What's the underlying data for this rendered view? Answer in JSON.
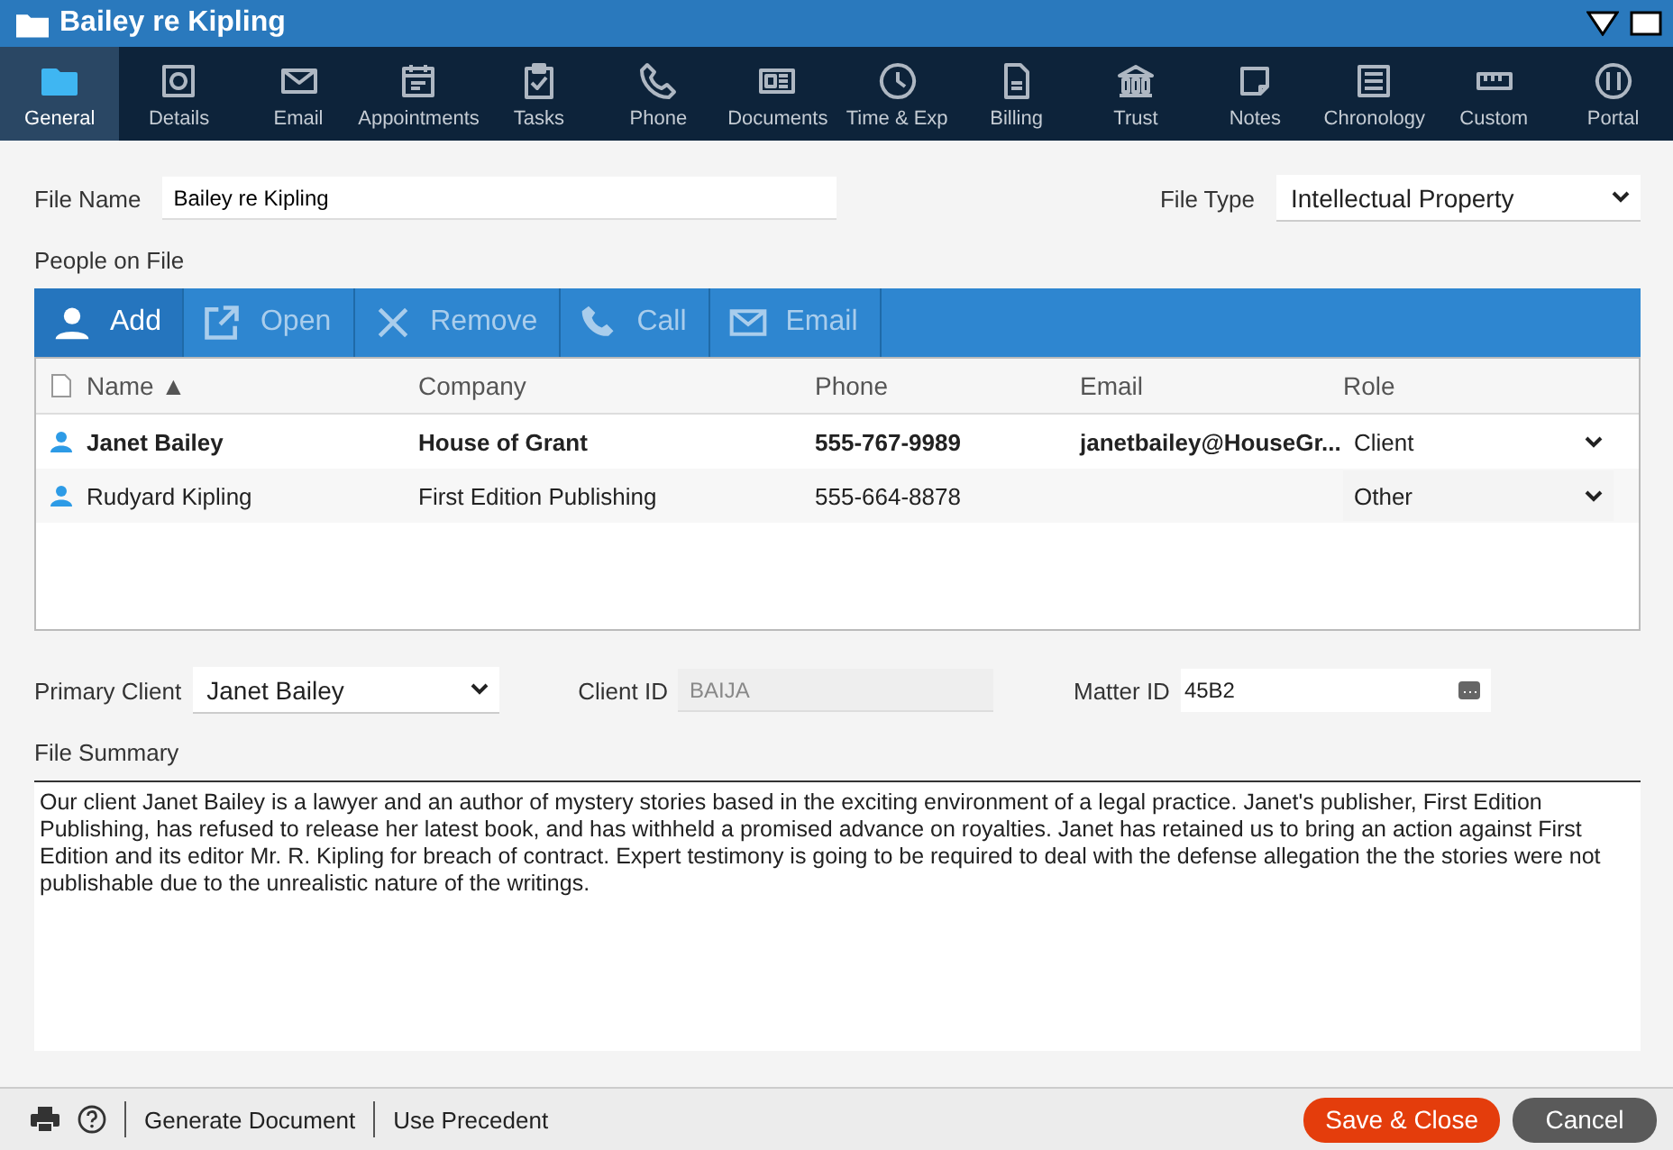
{
  "window": {
    "title": "Bailey re Kipling"
  },
  "tabs": [
    {
      "label": "General",
      "selected": true
    },
    {
      "label": "Details",
      "selected": false
    },
    {
      "label": "Email",
      "selected": false
    },
    {
      "label": "Appointments",
      "selected": false
    },
    {
      "label": "Tasks",
      "selected": false
    },
    {
      "label": "Phone",
      "selected": false
    },
    {
      "label": "Documents",
      "selected": false
    },
    {
      "label": "Time & Exp",
      "selected": false
    },
    {
      "label": "Billing",
      "selected": false
    },
    {
      "label": "Trust",
      "selected": false
    },
    {
      "label": "Notes",
      "selected": false
    },
    {
      "label": "Chronology",
      "selected": false
    },
    {
      "label": "Custom",
      "selected": false
    },
    {
      "label": "Portal",
      "selected": false
    }
  ],
  "file_name": {
    "label": "File Name",
    "value": "Bailey re Kipling"
  },
  "file_type": {
    "label": "File Type",
    "value": "Intellectual Property"
  },
  "people": {
    "heading": "People on File",
    "toolbar": [
      {
        "label": "Add",
        "disabled": false
      },
      {
        "label": "Open",
        "disabled": true
      },
      {
        "label": "Remove",
        "disabled": true
      },
      {
        "label": "Call",
        "disabled": true
      },
      {
        "label": "Email",
        "disabled": true
      }
    ],
    "columns": [
      "Name ▲",
      "Company",
      "Phone",
      "Email",
      "Role"
    ],
    "rows": [
      {
        "name": "Janet Bailey",
        "company": "House of Grant",
        "phone": "555-767-9989",
        "email": "janetbailey@HouseGr...",
        "role": "Client",
        "selected": true
      },
      {
        "name": "Rudyard Kipling",
        "company": "First Edition Publishing",
        "phone": "555-664-8878",
        "role": "Other",
        "selected": false
      }
    ]
  },
  "primary_client": {
    "label": "Primary Client",
    "value": "Janet Bailey"
  },
  "client_id": {
    "label": "Client ID",
    "value": "BAIJA",
    "disabled": true
  },
  "matter_id": {
    "label": "Matter ID",
    "value": "45B2"
  },
  "file_summary": {
    "label": "File Summary",
    "value": "Our client Janet Bailey is a lawyer and an author of mystery stories based in the exciting environment of a legal practice. Janet's publisher, First Edition Publishing, has refused to release her latest book, and has withheld a promised advance on royalties. Janet has retained us to bring an action against First Edition and its editor Mr. R. Kipling for breach of contract. Expert testimony is going to be required to deal with the defense allegation the the stories were not publishable due to the unrealistic nature of the writings."
  },
  "footer": {
    "links": [
      "Generate Document",
      "Use Precedent"
    ],
    "save": "Save & Close",
    "cancel": "Cancel"
  }
}
